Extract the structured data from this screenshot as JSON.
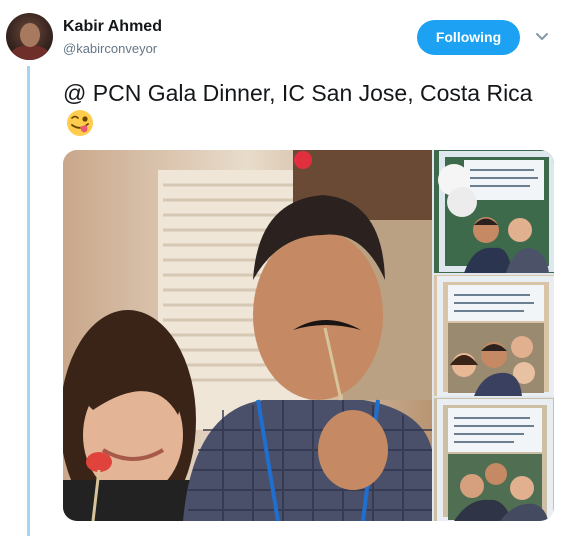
{
  "tweet": {
    "author_name": "Kabir Ahmed",
    "author_handle": "@kabirconveyor",
    "follow_label": "Following",
    "text": "@ PCN Gala Dinner, IC San Jose, Costa Rica",
    "emoji": "winking-face-with-tongue"
  },
  "colors": {
    "follow_button": "#1da1f2",
    "thread_line": "#a6d4f2",
    "handle_text": "#657786"
  },
  "media": {
    "count": 4,
    "main_photo": "two-people-with-mustache-and-lips-props",
    "thumbnails": [
      "photo-booth-frame-group-1",
      "photo-booth-frame-group-2",
      "photo-booth-frame-group-3"
    ]
  }
}
